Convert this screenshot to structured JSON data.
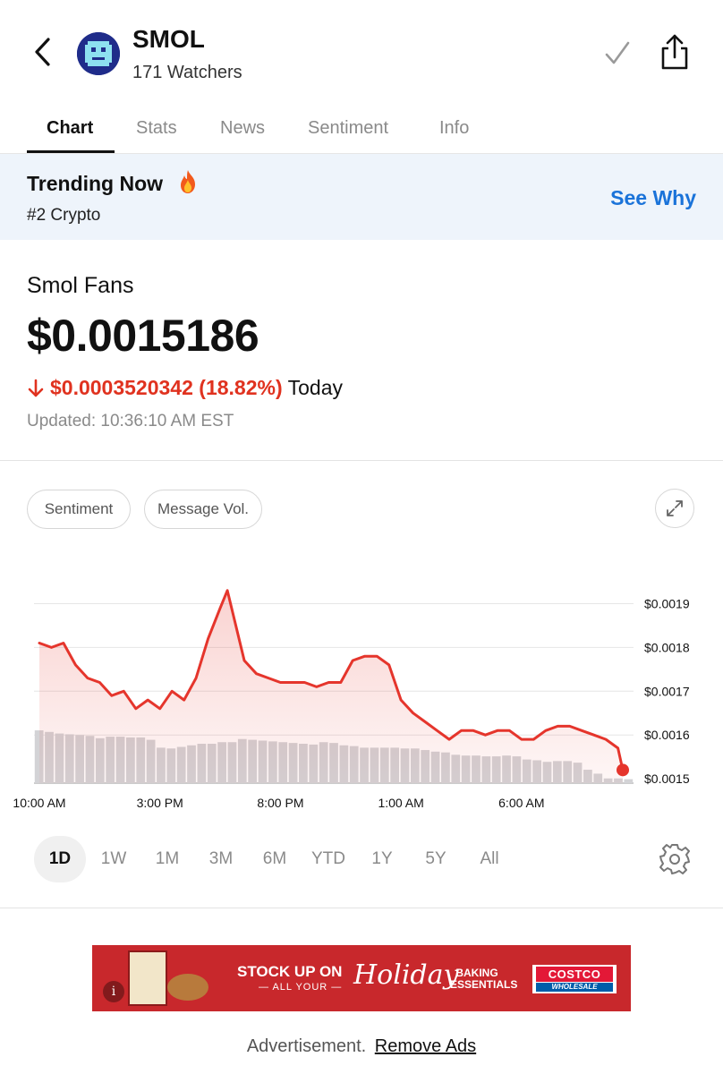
{
  "header": {
    "title": "SMOL",
    "watchers": "171 Watchers",
    "icons": [
      "chevron-left-icon",
      "checkmark-icon",
      "share-icon"
    ]
  },
  "tabs": [
    {
      "label": "Chart",
      "active": true
    },
    {
      "label": "Stats",
      "active": false
    },
    {
      "label": "News",
      "active": false
    },
    {
      "label": "Sentiment",
      "active": false
    },
    {
      "label": "Info",
      "active": false
    }
  ],
  "trending": {
    "title": "Trending Now",
    "subtitle": "#2 Crypto",
    "action": "See Why",
    "icon": "fire-icon"
  },
  "quote": {
    "name": "Smol Fans",
    "price": "$0.0015186",
    "change": "$0.0003520342 (18.82%)",
    "period": "Today",
    "direction": "down",
    "updated": "Updated: 10:36:10 AM EST"
  },
  "overlays": {
    "sentiment": "Sentiment",
    "message_vol": "Message Vol."
  },
  "ranges": [
    {
      "label": "1D",
      "active": true
    },
    {
      "label": "1W",
      "active": false
    },
    {
      "label": "1M",
      "active": false
    },
    {
      "label": "3M",
      "active": false
    },
    {
      "label": "6M",
      "active": false
    },
    {
      "label": "YTD",
      "active": false
    },
    {
      "label": "1Y",
      "active": false
    },
    {
      "label": "5Y",
      "active": false
    },
    {
      "label": "All",
      "active": false
    }
  ],
  "ad": {
    "headline": "STOCK UP ON",
    "subline": "— ALL YOUR —",
    "script": "Holiday",
    "tagline_1": "BAKING",
    "tagline_2": "ESSENTIALS",
    "brand": "COSTCO",
    "brand_sub": "WHOLESALE",
    "footer_label": "Advertisement.",
    "footer_link": "Remove Ads"
  },
  "colors": {
    "accent": "#1a73d9",
    "down": "#e0321f",
    "line": "#e5352c",
    "volume": "#d3d3d6"
  },
  "chart_data": {
    "type": "line",
    "y_ticks": [
      "$0.0019",
      "$0.0018",
      "$0.0017",
      "$0.0016",
      "$0.0015"
    ],
    "ylim": [
      0.00149,
      0.00195
    ],
    "x_ticks": [
      {
        "label": "10:00 AM",
        "hour": 0
      },
      {
        "label": "3:00 PM",
        "hour": 5
      },
      {
        "label": "8:00 PM",
        "hour": 10
      },
      {
        "label": "1:00 AM",
        "hour": 15
      },
      {
        "label": "6:00 AM",
        "hour": 20
      }
    ],
    "x_range_hours": [
      0,
      24.2
    ],
    "grid": true,
    "series": [
      {
        "values": [
          [
            0.0,
            0.00181
          ],
          [
            0.5,
            0.0018
          ],
          [
            1.0,
            0.00181
          ],
          [
            1.5,
            0.00176
          ],
          [
            2.0,
            0.00173
          ],
          [
            2.5,
            0.00172
          ],
          [
            3.0,
            0.00169
          ],
          [
            3.5,
            0.0017
          ],
          [
            4.0,
            0.00166
          ],
          [
            4.5,
            0.00168
          ],
          [
            5.0,
            0.00166
          ],
          [
            5.5,
            0.0017
          ],
          [
            6.0,
            0.00168
          ],
          [
            6.5,
            0.00173
          ],
          [
            7.0,
            0.00182
          ],
          [
            7.5,
            0.00189
          ],
          [
            7.8,
            0.00193
          ],
          [
            8.5,
            0.00177
          ],
          [
            9.0,
            0.00174
          ],
          [
            9.5,
            0.00173
          ],
          [
            10.0,
            0.00172
          ],
          [
            10.5,
            0.00172
          ],
          [
            11.0,
            0.00172
          ],
          [
            11.5,
            0.00171
          ],
          [
            12.0,
            0.00172
          ],
          [
            12.5,
            0.00172
          ],
          [
            13.0,
            0.00177
          ],
          [
            13.5,
            0.00178
          ],
          [
            14.0,
            0.00178
          ],
          [
            14.5,
            0.00176
          ],
          [
            15.0,
            0.00168
          ],
          [
            15.5,
            0.00165
          ],
          [
            16.0,
            0.00163
          ],
          [
            16.5,
            0.00161
          ],
          [
            17.0,
            0.00159
          ],
          [
            17.5,
            0.00161
          ],
          [
            18.0,
            0.00161
          ],
          [
            18.5,
            0.0016
          ],
          [
            19.0,
            0.00161
          ],
          [
            19.5,
            0.00161
          ],
          [
            20.0,
            0.00159
          ],
          [
            20.5,
            0.00159
          ],
          [
            21.0,
            0.00161
          ],
          [
            21.5,
            0.00162
          ],
          [
            22.0,
            0.00162
          ],
          [
            22.5,
            0.00161
          ],
          [
            23.0,
            0.0016
          ],
          [
            23.5,
            0.00159
          ],
          [
            24.0,
            0.00157
          ],
          [
            24.2,
            0.00152
          ]
        ]
      }
    ],
    "volume": [
      0.67,
      0.65,
      0.63,
      0.62,
      0.61,
      0.6,
      0.57,
      0.59,
      0.59,
      0.58,
      0.58,
      0.55,
      0.45,
      0.44,
      0.46,
      0.48,
      0.5,
      0.5,
      0.52,
      0.52,
      0.56,
      0.55,
      0.54,
      0.53,
      0.52,
      0.51,
      0.5,
      0.49,
      0.52,
      0.51,
      0.48,
      0.47,
      0.45,
      0.45,
      0.45,
      0.45,
      0.44,
      0.44,
      0.42,
      0.4,
      0.39,
      0.36,
      0.35,
      0.35,
      0.34,
      0.34,
      0.35,
      0.34,
      0.3,
      0.29,
      0.27,
      0.28,
      0.28,
      0.26,
      0.17,
      0.12,
      0.06,
      0.06,
      0.05
    ]
  }
}
